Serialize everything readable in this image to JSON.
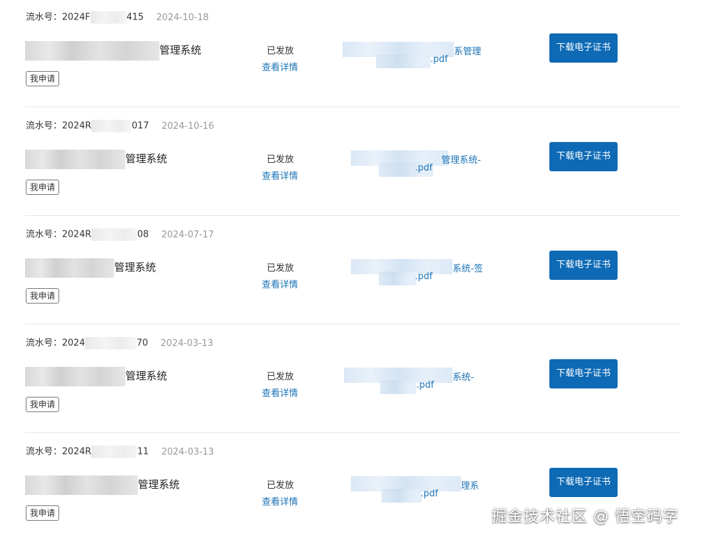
{
  "records": [
    {
      "serial_label": "流水号：",
      "serial_prefix": "2024F",
      "serial_suffix": "415",
      "date": "2024-10-18",
      "name_suffix": "管理系统",
      "tag": "我申请",
      "status": "已发放",
      "detail_link": "查看详情",
      "file_end_line1": "系管理",
      "file_end_line2": ".pdf",
      "download_label": "下载电子证书"
    },
    {
      "serial_label": "流水号：",
      "serial_prefix": "2024R",
      "serial_suffix": "017",
      "date": "2024-10-16",
      "name_suffix": "管理系统",
      "tag": "我申请",
      "status": "已发放",
      "detail_link": "查看详情",
      "file_end_line1": "管理系统-",
      "file_end_line2": ".pdf",
      "download_label": "下载电子证书"
    },
    {
      "serial_label": "流水号：",
      "serial_prefix": "2024R",
      "serial_suffix": "08",
      "date": "2024-07-17",
      "name_suffix": "管理系统",
      "tag": "我申请",
      "status": "已发放",
      "detail_link": "查看详情",
      "file_end_line1": "系统-签",
      "file_end_line2": ".pdf",
      "download_label": "下载电子证书"
    },
    {
      "serial_label": "流水号：",
      "serial_prefix": "2024",
      "serial_suffix": "70",
      "date": "2024-03-13",
      "name_suffix": "管理系统",
      "tag": "我申请",
      "status": "已发放",
      "detail_link": "查看详情",
      "file_end_line1": "系统-",
      "file_end_line2": ".pdf",
      "download_label": "下载电子证书"
    },
    {
      "serial_label": "流水号：",
      "serial_prefix": "2024R",
      "serial_suffix": "11",
      "date": "2024-03-13",
      "name_suffix": "管理系统",
      "tag": "我申请",
      "status": "已发放",
      "detail_link": "查看详情",
      "file_end_line1": "理系",
      "file_end_line2": ".pdf",
      "download_label": "下载电子证书"
    }
  ],
  "watermark": "掘金技术社区 @ 悟空码字",
  "colors": {
    "accent_button": "#0e6ab5",
    "link": "#1a73b6",
    "date_gray": "#999999",
    "divider": "#e6e6e6"
  }
}
